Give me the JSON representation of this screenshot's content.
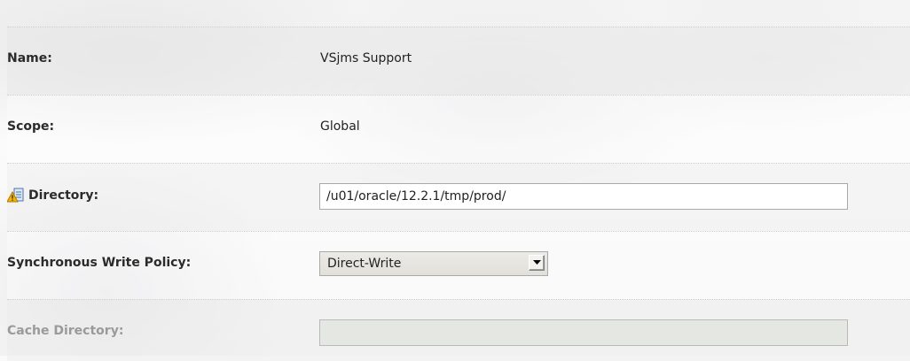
{
  "fields": {
    "name": {
      "label": "Name:",
      "value": "VSjms Support"
    },
    "scope": {
      "label": "Scope:",
      "value": "Global"
    },
    "directory": {
      "label": "Directory:",
      "value": "/u01/oracle/12.2.1/tmp/prod/",
      "icon": "warning-config-icon"
    },
    "sync_write_policy": {
      "label": "Synchronous Write Policy:",
      "value": "Direct-Write",
      "icon": "dropdown-arrow-icon"
    },
    "cache_directory": {
      "label": "Cache Directory:",
      "value": ""
    }
  }
}
